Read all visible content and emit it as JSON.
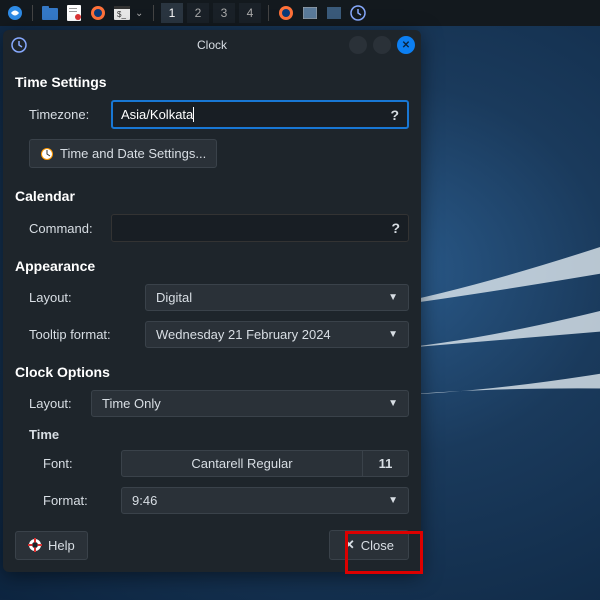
{
  "taskbar": {
    "workspaces": [
      "1",
      "2",
      "3",
      "4"
    ]
  },
  "dialog": {
    "title": "Clock",
    "timeSettings": {
      "heading": "Time Settings",
      "timezoneLabel": "Timezone:",
      "timezoneValue": "Asia/Kolkata",
      "tdsButton": "Time and Date Settings..."
    },
    "calendar": {
      "heading": "Calendar",
      "commandLabel": "Command:"
    },
    "appearance": {
      "heading": "Appearance",
      "layoutLabel": "Layout:",
      "layoutValue": "Digital",
      "tooltipLabel": "Tooltip format:",
      "tooltipValue": "Wednesday 21 February 2024"
    },
    "clockOptions": {
      "heading": "Clock Options",
      "layoutLabel": "Layout:",
      "layoutValue": "Time Only",
      "timeHeading": "Time",
      "fontLabel": "Font:",
      "fontValue": "Cantarell Regular",
      "fontSize": "11",
      "formatLabel": "Format:",
      "formatValue": "9:46"
    },
    "footer": {
      "help": "Help",
      "close": "Close"
    }
  }
}
